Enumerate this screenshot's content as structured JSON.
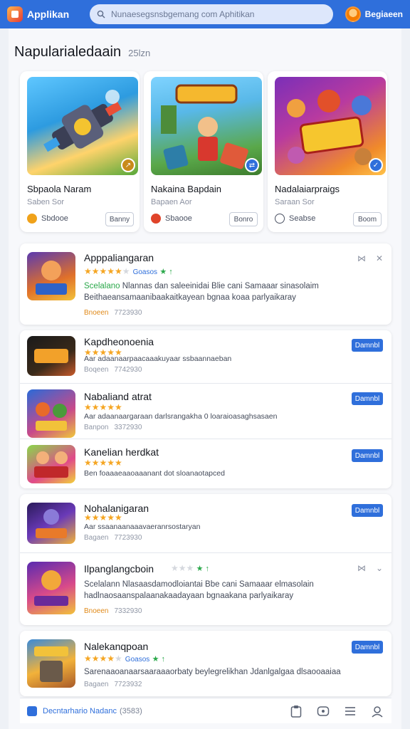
{
  "header": {
    "app_title": "Applikan",
    "search_placeholder": "Nunaesegsnsbgemang com Aphitikan",
    "user_name": "Begiaeen"
  },
  "section": {
    "title": "Napularialedaain",
    "count": "25lzn"
  },
  "featured": [
    {
      "name": "Sbpaola Naram",
      "sub": "Saben Sor",
      "dev": "Sbdooe",
      "button": "Banny"
    },
    {
      "name": "Nakaina Bapdain",
      "sub": "Bapaen Aor",
      "dev": "Sbaooe",
      "button": "Bonro"
    },
    {
      "name": "Nadalaiarpraigs",
      "sub": "Saraan Sor",
      "dev": "Seabse",
      "button": "Boom"
    }
  ],
  "list": [
    {
      "title": "Apppaliangaran",
      "rating_label": "Goasos",
      "desc_highlight": "Scelalano",
      "desc": "Nlannas dan saleeinidai Blie cani Samaaar sinasolaim Beithaeansamaanibaakaitkayean bgnaa koaa parlyaikaray",
      "date_label": "Bnoeen",
      "date": "7723930"
    },
    {
      "title": "Kapdheonoenia",
      "desc": "Aar adaanaarpaacaaakuyaar ssbaannaeban",
      "date_label": "Boqeen",
      "date": "7742930",
      "button": "Damnbl"
    },
    {
      "title": "Nabaliand atrat",
      "desc": "Aar adaanaargaraan darlsrangakha 0 loaraioasaghsasaen",
      "date_label": "Banpon",
      "date": "3372930",
      "button": "Damnbl"
    },
    {
      "title": "Kanelian herdkat",
      "desc": "Ben foaaaeaaoaaanant dot sloanaotapced",
      "button": "Damnbl"
    },
    {
      "title": "Nohalanigaran",
      "desc": "Aar ssaanaanaaavaeranrsostaryan",
      "date_label": "Bagaen",
      "date": "7723930",
      "button": "Damnbl"
    },
    {
      "title": "Ilpanglangcboin",
      "desc": "Scelalann Nlasaasdamodloiantai Bbe cani Samaaar elmasolain hadlnaosaanspalaanakaadayaan bgnaakana parlyaikaray",
      "date_label": "Bnoeen",
      "date": "7332930"
    },
    {
      "title": "Nalekanqpoan",
      "rating_label": "Goasos",
      "desc": "Sarenaaoanaarsaaraaaorbaty beylegrelikhan Jdanlgalgaa dlsaooaaiaa",
      "date_label": "Bagaen",
      "date": "7723932",
      "button": "Damnbl"
    }
  ],
  "bottom_bar": {
    "label": "Decntarhario Nadanc",
    "count": "(3583)"
  },
  "colors": {
    "primary": "#2f6fdb",
    "star": "#f5a623",
    "green": "#2aa84a"
  }
}
